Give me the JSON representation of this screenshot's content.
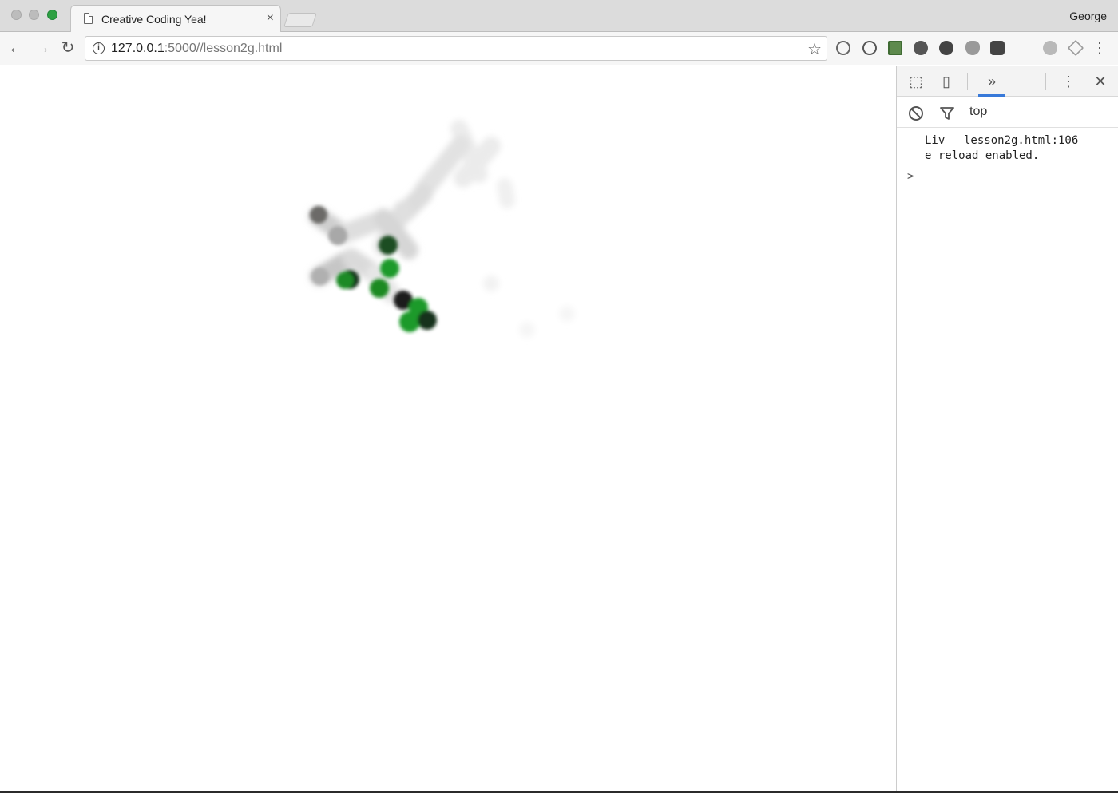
{
  "browser": {
    "tab_title": "Creative Coding Yea!",
    "tab_close_glyph": "×",
    "profile_name": "George",
    "url_host": "127.0.0.1",
    "url_rest": ":5000//lesson2g.html",
    "nav": {
      "back": "←",
      "forward": "→",
      "reload": "↻"
    },
    "star_glyph": "☆",
    "menu_glyph": "⋮",
    "extension_icons": [
      "sync-icon",
      "opera-icon",
      "calendar-icon",
      "pinterest-icon",
      "globe-icon",
      "shield-icon",
      "pocket-icon",
      "orb-icon",
      "drive-icon"
    ]
  },
  "devtools": {
    "more_tabs_glyph": "»",
    "menu_glyph": "⋮",
    "close_glyph": "✕",
    "context_label": "top",
    "console_message_part1": "Liv",
    "console_message_link": "lesson2g.html:106",
    "console_message_part2": "e reload enabled.",
    "prompt_glyph": ">"
  },
  "canvas": {
    "accent_green": "#1f9a2a",
    "dark_green": "#17331a"
  }
}
